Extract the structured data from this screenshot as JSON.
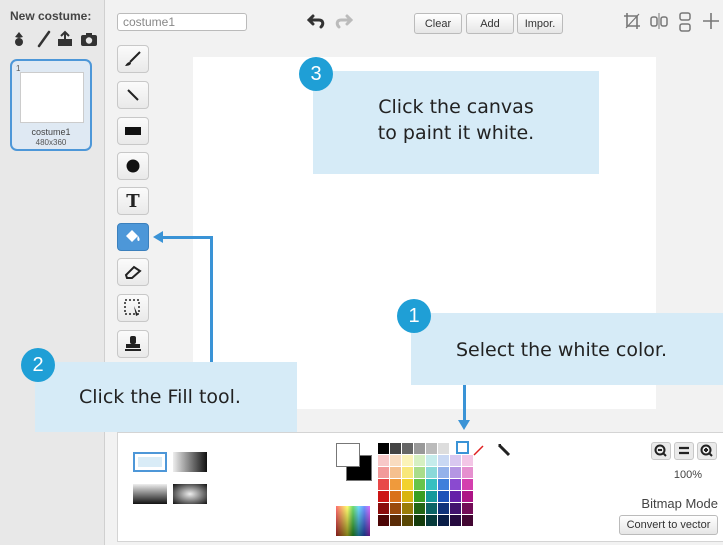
{
  "costumes_pane": {
    "new_costume_label": "New costume:",
    "new_costume_icons": [
      "sprite-library-icon",
      "paint-brush-icon",
      "upload-icon",
      "camera-icon"
    ],
    "costume": {
      "index": "1",
      "name": "costume1",
      "size": "480x360"
    }
  },
  "editor": {
    "costume_name_value": "costume1",
    "toolbar": {
      "clear": "Clear",
      "add": "Add",
      "import": "Impor."
    },
    "tools": [
      {
        "name": "brush-tool",
        "icon": "brush-icon"
      },
      {
        "name": "line-tool",
        "icon": "line-icon"
      },
      {
        "name": "rectangle-tool",
        "icon": "rectangle-icon"
      },
      {
        "name": "ellipse-tool",
        "icon": "ellipse-icon"
      },
      {
        "name": "text-tool",
        "icon": "text-icon",
        "glyph": "T"
      },
      {
        "name": "fill-tool",
        "icon": "fill-bucket-icon",
        "active": true
      },
      {
        "name": "eraser-tool",
        "icon": "eraser-icon"
      },
      {
        "name": "select-tool",
        "icon": "select-icon"
      },
      {
        "name": "stamp-tool",
        "icon": "stamp-icon"
      }
    ],
    "zoom": "100%",
    "mode_label": "Bitmap Mode",
    "convert_button": "Convert to vector",
    "accent_color": "#4d97d8"
  },
  "callouts": {
    "step1": {
      "number": "1",
      "text": "Select the white color."
    },
    "step2": {
      "number": "2",
      "text": "Click the Fill tool."
    },
    "step3": {
      "number": "3",
      "text_line1": "Click the canvas",
      "text_line2": "to paint it white."
    },
    "callout_bg": "#d6ebf7",
    "bubble_color": "#1f9fd6"
  },
  "palette": {
    "rows": [
      [
        "#000000",
        "#444444",
        "#666666",
        "#999999",
        "#bbbbbb",
        "#dddddd",
        "#ffffff",
        "#ff0000"
      ],
      [
        "#f7c8c8",
        "#f9dcc0",
        "#fbf3b8",
        "#d6f0c2",
        "#c5ecec",
        "#c9d8f3",
        "#d9c8f0",
        "#f3c6e6"
      ],
      [
        "#f29a9a",
        "#f5c08f",
        "#f8e77a",
        "#a9dd8a",
        "#8ad9d9",
        "#94b2ea",
        "#b596e3",
        "#e690cf"
      ],
      [
        "#e84848",
        "#ef9a3c",
        "#f2d22d",
        "#67c449",
        "#37c0c0",
        "#3f7fdb",
        "#8a4ad0",
        "#d43fae"
      ],
      [
        "#cc1414",
        "#d9711a",
        "#d9b40f",
        "#3a9e22",
        "#14999c",
        "#1d52b8",
        "#6520a8",
        "#ad1486"
      ],
      [
        "#8a0b0b",
        "#9a4a0c",
        "#9a7d07",
        "#236614",
        "#0b6466",
        "#10327a",
        "#41126e",
        "#730c57"
      ],
      [
        "#4d0505",
        "#5a2b06",
        "#5a4804",
        "#143b0b",
        "#063a3b",
        "#091d47",
        "#260a40",
        "#420632"
      ]
    ]
  }
}
